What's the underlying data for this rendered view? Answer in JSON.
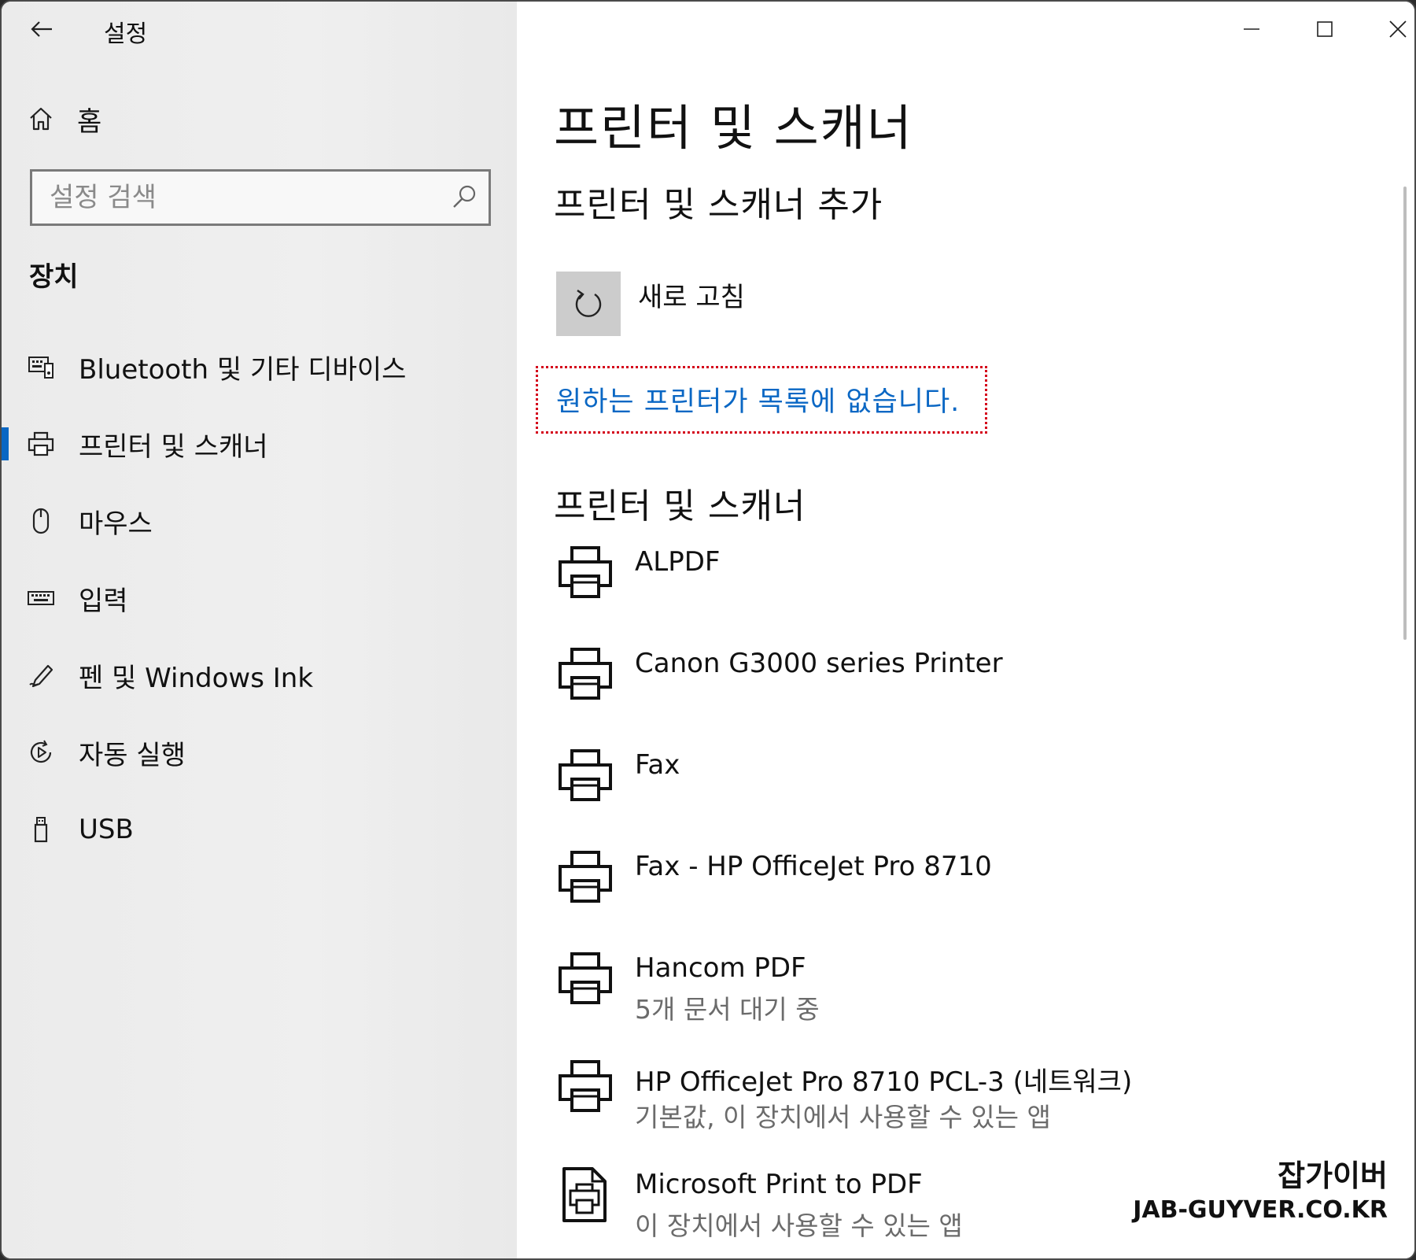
{
  "window": {
    "title": "설정"
  },
  "sidebar": {
    "home_label": "홈",
    "search_placeholder": "설정 검색",
    "section_title": "장치",
    "items": [
      {
        "label": "Bluetooth 및 기타 디바이스",
        "icon": "bluetooth-devices-icon",
        "active": false
      },
      {
        "label": "프린터 및 스캐너",
        "icon": "printer-icon",
        "active": true
      },
      {
        "label": "마우스",
        "icon": "mouse-icon",
        "active": false
      },
      {
        "label": "입력",
        "icon": "keyboard-icon",
        "active": false
      },
      {
        "label": "펜 및 Windows Ink",
        "icon": "pen-icon",
        "active": false
      },
      {
        "label": "자동 실행",
        "icon": "autoplay-icon",
        "active": false
      },
      {
        "label": "USB",
        "icon": "usb-icon",
        "active": false
      }
    ]
  },
  "main": {
    "page_title": "프린터 및 스캐너",
    "add_section_title": "프린터 및 스캐너 추가",
    "refresh_label": "새로 고침",
    "missing_printer_link": "원하는 프린터가 목록에 없습니다.",
    "list_section_title": "프린터 및 스캐너",
    "printers": [
      {
        "name": "ALPDF",
        "status": "",
        "icon": "printer-icon"
      },
      {
        "name": "Canon G3000 series Printer",
        "status": "",
        "icon": "printer-icon"
      },
      {
        "name": "Fax",
        "status": "",
        "icon": "printer-icon"
      },
      {
        "name": "Fax - HP OfficeJet Pro 8710",
        "status": "",
        "icon": "printer-icon"
      },
      {
        "name": "Hancom PDF",
        "status": "5개 문서 대기 중",
        "icon": "printer-icon"
      },
      {
        "name": "HP OfficeJet Pro 8710 PCL-3 (네트워크)",
        "status": "기본값, 이 장치에서 사용할 수 있는 앱",
        "icon": "printer-icon"
      },
      {
        "name": "Microsoft Print to PDF",
        "status": "이 장치에서 사용할 수 있는 앱",
        "icon": "pdf-printer-icon"
      }
    ]
  },
  "watermark": {
    "name": "잡가이버",
    "site": "JAB-GUYVER.CO.KR"
  },
  "colors": {
    "accent": "#0a67c4",
    "highlight_border": "#d4001a",
    "sidebar_bg": "#ececec"
  }
}
